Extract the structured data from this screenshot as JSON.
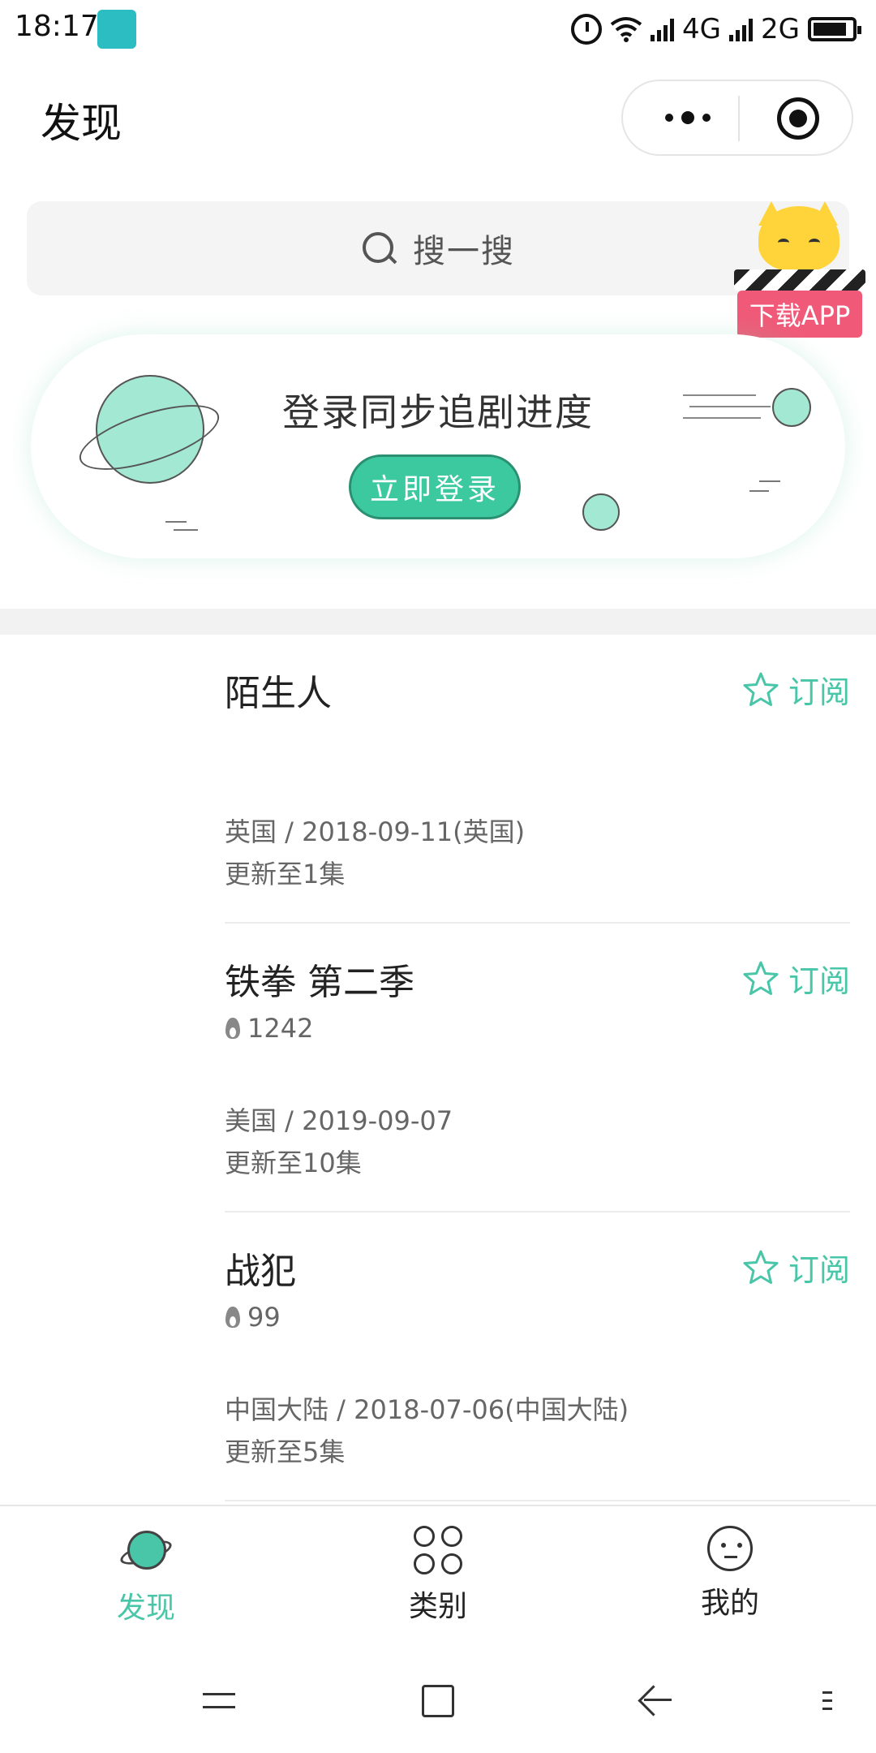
{
  "status_bar": {
    "time": "18:17",
    "network_1": "4G",
    "network_2": "2G",
    "icons": [
      "scan-icon",
      "alarm-icon",
      "wifi-icon",
      "signal-icon",
      "battery-icon"
    ]
  },
  "header": {
    "title": "发现",
    "capsule_icons": [
      "more-icon",
      "close-target-icon"
    ]
  },
  "search": {
    "placeholder": "搜一搜"
  },
  "app_download": {
    "label": "下载APP"
  },
  "login_banner": {
    "title": "登录同步追剧进度",
    "button_label": "立即登录"
  },
  "shows": [
    {
      "title": "陌生人",
      "hot": "",
      "meta": "英国 / 2018-09-11(英国)",
      "episodes": "更新至1集",
      "subscribe_label": "订阅"
    },
    {
      "title": "铁拳 第二季",
      "hot": "1242",
      "meta": "美国 / 2019-09-07",
      "episodes": "更新至10集",
      "subscribe_label": "订阅"
    },
    {
      "title": "战犯",
      "hot": "99",
      "meta": "中国大陆 / 2018-07-06(中国大陆)",
      "episodes": "更新至5集",
      "subscribe_label": "订阅"
    }
  ],
  "tabbar": {
    "tabs": [
      {
        "label": "发现",
        "icon": "planet-icon",
        "active": true
      },
      {
        "label": "类别",
        "icon": "grid-icon",
        "active": false
      },
      {
        "label": "我的",
        "icon": "face-icon",
        "active": false
      }
    ]
  },
  "colors": {
    "accent": "#49c6a8",
    "login_button": "#3cc9a0",
    "app_badge": "#f05a78"
  }
}
